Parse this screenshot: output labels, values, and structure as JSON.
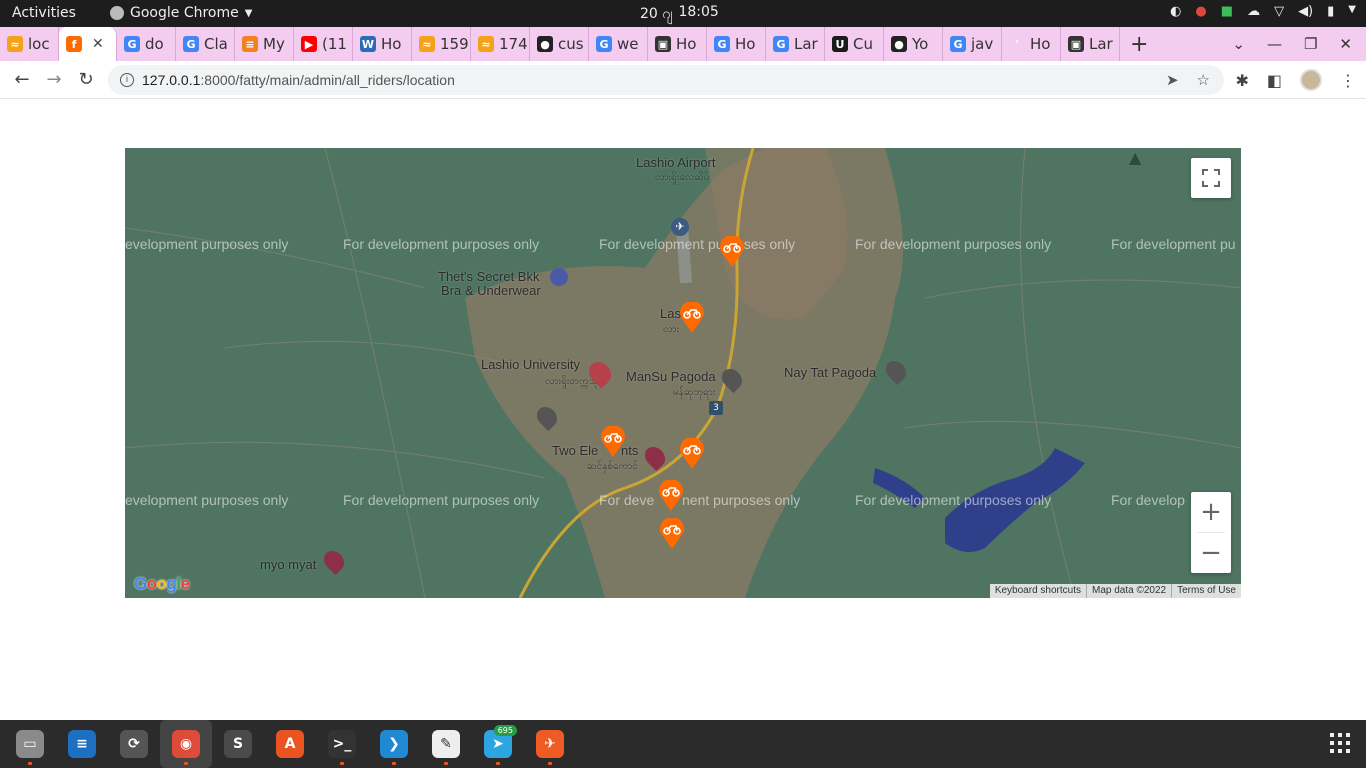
{
  "topbar": {
    "activities": "Activities",
    "app_name": "Google Chrome",
    "date": "20 ဂျ",
    "time": "18:05"
  },
  "tabs": [
    {
      "title": "loc",
      "favicon": "fatty-icon",
      "color": "#f4a21c",
      "glyph": "≈"
    },
    {
      "title": "",
      "favicon": "fatty-app-icon",
      "color": "#ff6a00",
      "glyph": "f",
      "active": true
    },
    {
      "title": "do",
      "favicon": "google-icon",
      "color": "#4285f4",
      "glyph": "G"
    },
    {
      "title": "Cla",
      "favicon": "google-icon",
      "color": "#4285f4",
      "glyph": "G"
    },
    {
      "title": "My",
      "favicon": "stackoverflow-icon",
      "color": "#f48024",
      "glyph": "≡"
    },
    {
      "title": "(11",
      "favicon": "youtube-icon",
      "color": "#ff0000",
      "glyph": "▶"
    },
    {
      "title": "Ho",
      "favicon": "w3schools-icon",
      "color": "#2c6bb4",
      "glyph": "W"
    },
    {
      "title": "159",
      "favicon": "fatty-icon",
      "color": "#f4a21c",
      "glyph": "≈"
    },
    {
      "title": "174",
      "favicon": "fatty-icon",
      "color": "#f4a21c",
      "glyph": "≈"
    },
    {
      "title": "cus",
      "favicon": "github-icon",
      "color": "#222222",
      "glyph": "●"
    },
    {
      "title": "we",
      "favicon": "google-icon",
      "color": "#4285f4",
      "glyph": "G"
    },
    {
      "title": "Ho",
      "favicon": "dev-icon",
      "color": "#333333",
      "glyph": "▣"
    },
    {
      "title": "Ho",
      "favicon": "google-icon",
      "color": "#4285f4",
      "glyph": "G"
    },
    {
      "title": "Lar",
      "favicon": "google-icon",
      "color": "#4285f4",
      "glyph": "G"
    },
    {
      "title": "Cu",
      "favicon": "upwork-icon",
      "color": "#1b1b1b",
      "glyph": "U"
    },
    {
      "title": "Yo",
      "favicon": "github-icon",
      "color": "#222222",
      "glyph": "●"
    },
    {
      "title": "jav",
      "favicon": "google-icon",
      "color": "#4285f4",
      "glyph": "G"
    },
    {
      "title": "Ho",
      "favicon": "blank-icon",
      "color": "#f3ccf0",
      "glyph": "'"
    },
    {
      "title": "Lar",
      "favicon": "dev-icon",
      "color": "#333333",
      "glyph": "▣"
    }
  ],
  "url": {
    "host": "127.0.0.1",
    "path": ":8000/fatty/main/admin/all_riders/location"
  },
  "map": {
    "watermark": "For development purposes only",
    "watermark_cut_left": "evelopment purposes only",
    "watermark_cut_right_1": "For development pu",
    "watermark_cut_right_2": "For develop",
    "watermark_cut_mid": "For deve",
    "watermark_cut_mid_2": "nent purposes only",
    "places": {
      "airport": "Lashio Airport",
      "airport_my": "လားရှိုးလေဆိပ်",
      "bra_shop_1": "Thet's Secret Bkk",
      "bra_shop_2": "Bra & Underwear",
      "lashio_town": "Las",
      "lashio_town_my": "လား",
      "university": "Lashio University",
      "university_my": "လားရှိုးတက္ကသိုလ်",
      "mansu": "ManSu Pagoda",
      "mansu_my": "မန်ဆုဘုရား",
      "naytat": "Nay Tat Pagoda",
      "two_elephants": "Two Ele",
      "two_elephants_2": "nts",
      "two_elephants_my": "ဆင်နှစ်ကောင်",
      "myo_myat": "myo myat",
      "route_3": "3"
    },
    "rider_count": 6,
    "attribution": {
      "shortcuts": "Keyboard shortcuts",
      "map_data": "Map data ©2022",
      "terms": "Terms of Use"
    },
    "logo": "Google",
    "zoom_in": "+",
    "zoom_out": "−"
  },
  "dock": {
    "telegram_badge": "695",
    "items": [
      "files-icon",
      "writer-icon",
      "updater-icon",
      "chrome-icon",
      "sublime-icon",
      "software-icon",
      "terminal-icon",
      "vscode-icon",
      "text-editor-icon",
      "telegram-icon",
      "postman-icon"
    ]
  }
}
